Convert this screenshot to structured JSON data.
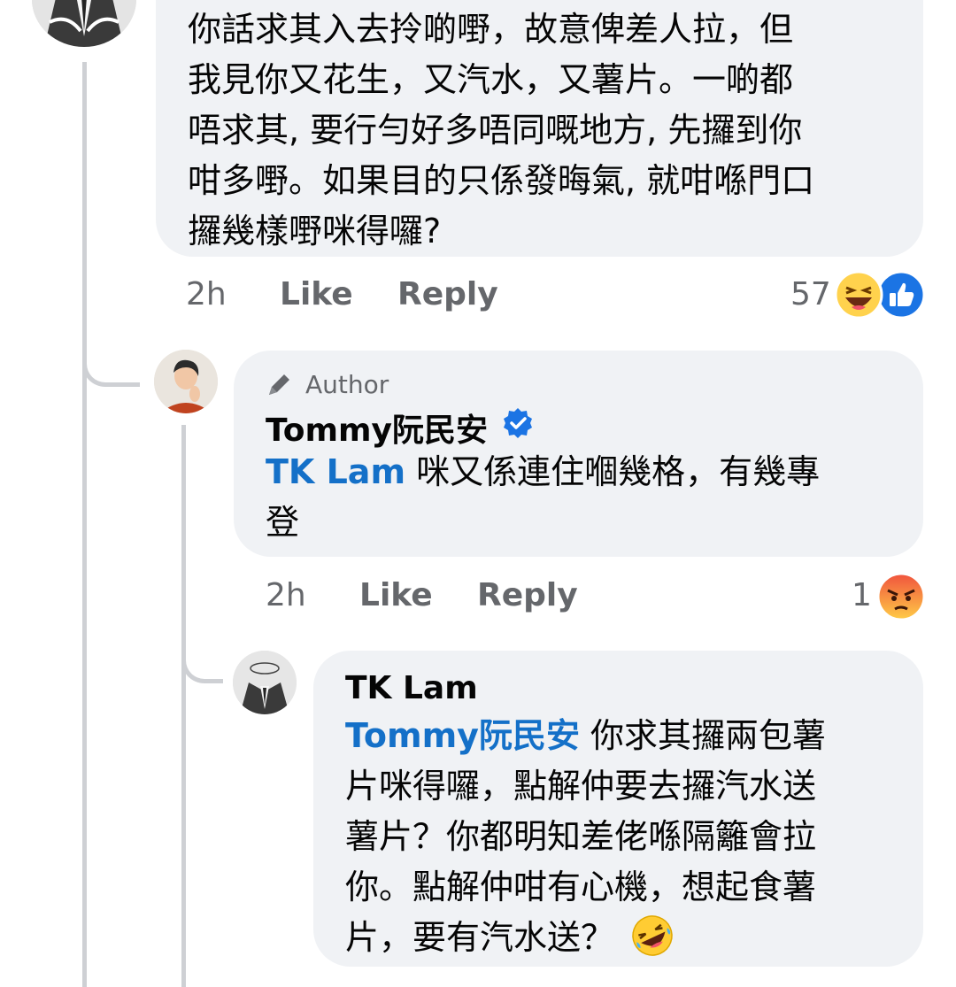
{
  "comments": [
    {
      "text_lines": [
        "你話求其入去拎啲嘢，故意俾差人拉，但",
        "我見你又花生，又汽水，又薯片。一啲都",
        "唔求其, 要行勻好多唔同嘅地方, 先攞到你",
        "咁多嘢。如果目的只係發晦氣, 就咁喺門口",
        "攞幾樣嘢咪得囉?"
      ],
      "time": "2h",
      "like_label": "Like",
      "reply_label": "Reply",
      "reaction_count": "57",
      "reactions": [
        "haha-emoji",
        "like-emoji"
      ]
    },
    {
      "badge_label": "Author",
      "author": "Tommy阮民安",
      "verified": true,
      "mention": "TK Lam",
      "text_line1": "咪又係連住嗰幾格，有幾專",
      "text_line2": "登",
      "time": "2h",
      "like_label": "Like",
      "reply_label": "Reply",
      "reaction_count": "1",
      "reactions": [
        "angry-emoji"
      ]
    },
    {
      "author": "TK Lam",
      "mention": "Tommy阮民安",
      "text_line1": "你求其攞兩包薯",
      "text_lines": [
        "片咪得囉，點解仲要去攞汽水送",
        "薯片？你都明知差佬喺隔籬會拉",
        "你。點解仲咁有心機，想起食薯",
        "片，要有汽水送？"
      ],
      "trailing_emoji": "rofl-emoji"
    }
  ],
  "colors": {
    "bubble": "#f0f2f5",
    "mention": "#1470c8",
    "meta": "#65676b",
    "thread_line": "#ced0d4"
  }
}
